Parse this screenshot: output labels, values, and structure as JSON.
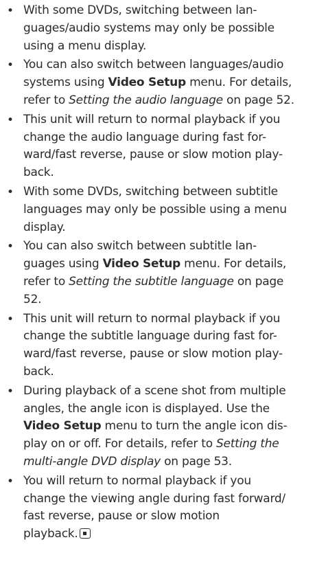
{
  "bullet_glyph": "•",
  "items": [
    {
      "l1": "With some DVDs, switching between lan-",
      "l2": "guages/audio systems may only be possible",
      "l3": "using a menu display."
    },
    {
      "l1": "You can also switch between languages/audio",
      "l2a": "systems using ",
      "l2b": "Video Setup",
      "l2c": " menu. For details,",
      "l3a": "refer to ",
      "l3b": "Setting the audio language",
      "l3c": " on page 52."
    },
    {
      "l1": "This unit will return to normal playback if you",
      "l2": "change the audio language during fast for-",
      "l3": "ward/fast reverse, pause or slow motion play-",
      "l4": "back."
    },
    {
      "l1": "With some DVDs, switching between subtitle",
      "l2": "languages may only be possible using a menu",
      "l3": "display."
    },
    {
      "l1": "You can also switch between subtitle lan-",
      "l2a": "guages using ",
      "l2b": "Video Setup",
      "l2c": " menu. For details,",
      "l3a": "refer to ",
      "l3b": "Setting the subtitle language",
      "l3c": " on page",
      "l4": "52."
    },
    {
      "l1": "This unit will return to normal playback if you",
      "l2": "change the subtitle language during fast for-",
      "l3": "ward/fast reverse, pause or slow motion play-",
      "l4": "back."
    },
    {
      "l1": "During playback of a scene shot from multiple",
      "l2": "angles, the angle icon is displayed. Use the",
      "l3a": "Video Setup",
      "l3b": " menu to turn the angle icon dis-",
      "l4a": "play on or off. For details, refer to ",
      "l4b": "Setting the",
      "l5a": "multi-angle DVD display",
      "l5b": " on page 53."
    },
    {
      "l1": "You will return to normal playback if you",
      "l2": "change the viewing angle during fast forward/",
      "l3": "fast reverse, pause or slow motion",
      "l4": "playback.",
      "end_icon": "stop-square-icon"
    }
  ]
}
